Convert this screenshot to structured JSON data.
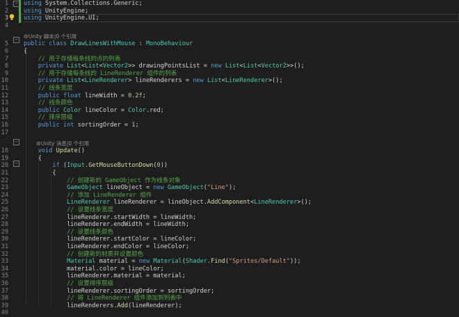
{
  "editor": {
    "lines": [
      {
        "n": "1",
        "segs": [
          [
            "kw",
            "using"
          ],
          [
            "pl",
            " System.Collections.Generic;"
          ]
        ]
      },
      {
        "n": "2",
        "segs": [
          [
            "kw",
            "using"
          ],
          [
            "pl",
            " UnityEngine;"
          ]
        ]
      },
      {
        "n": "3",
        "segs": [
          [
            "kw",
            "using"
          ],
          [
            "pl",
            " UnityEngine.UI;"
          ]
        ]
      },
      {
        "n": "4",
        "segs": []
      },
      {
        "lens": "⚙Unity 脚本|0 个引用"
      },
      {
        "n": "5",
        "segs": [
          [
            "kw",
            "public"
          ],
          [
            "pl",
            " "
          ],
          [
            "kw",
            "class"
          ],
          [
            "pl",
            " "
          ],
          [
            "ty",
            "DrawLinesWithMouse"
          ],
          [
            "pl",
            " : "
          ],
          [
            "ty",
            "MonoBehaviour"
          ]
        ]
      },
      {
        "n": "6",
        "segs": [
          [
            "pl",
            "{"
          ]
        ]
      },
      {
        "n": "7",
        "segs": [
          [
            "pl",
            "    "
          ],
          [
            "cm",
            "// 用于存储每条线的点的列表"
          ]
        ]
      },
      {
        "n": "8",
        "segs": [
          [
            "pl",
            "    "
          ],
          [
            "kw",
            "private"
          ],
          [
            "pl",
            " "
          ],
          [
            "ty",
            "List"
          ],
          [
            "pl",
            "<"
          ],
          [
            "ty",
            "List"
          ],
          [
            "pl",
            "<"
          ],
          [
            "ty",
            "Vector2"
          ],
          [
            "pl",
            ">> drawingPointsList = "
          ],
          [
            "kw",
            "new"
          ],
          [
            "pl",
            " "
          ],
          [
            "ty",
            "List"
          ],
          [
            "pl",
            "<"
          ],
          [
            "ty",
            "List"
          ],
          [
            "pl",
            "<"
          ],
          [
            "ty",
            "Vector2"
          ],
          [
            "pl",
            ">>();"
          ]
        ]
      },
      {
        "n": "9",
        "segs": [
          [
            "pl",
            "    "
          ],
          [
            "cm",
            "// 用于存储每条线的 LineRenderer 组件的列表"
          ]
        ]
      },
      {
        "n": "10",
        "segs": [
          [
            "pl",
            "    "
          ],
          [
            "kw",
            "private"
          ],
          [
            "pl",
            " "
          ],
          [
            "ty",
            "List"
          ],
          [
            "pl",
            "<"
          ],
          [
            "ty",
            "LineRenderer"
          ],
          [
            "pl",
            "> lineRenderers = "
          ],
          [
            "kw",
            "new"
          ],
          [
            "pl",
            " "
          ],
          [
            "ty",
            "List"
          ],
          [
            "pl",
            "<"
          ],
          [
            "ty",
            "LineRenderer"
          ],
          [
            "pl",
            ">();"
          ]
        ]
      },
      {
        "n": "11",
        "segs": [
          [
            "pl",
            "    "
          ],
          [
            "cm",
            "// 线条宽度"
          ]
        ]
      },
      {
        "n": "12",
        "segs": [
          [
            "pl",
            "    "
          ],
          [
            "kw",
            "public"
          ],
          [
            "pl",
            " "
          ],
          [
            "kw",
            "float"
          ],
          [
            "pl",
            " lineWidth = "
          ],
          [
            "num",
            "0.2f"
          ],
          [
            "pl",
            ";"
          ]
        ]
      },
      {
        "n": "13",
        "segs": [
          [
            "pl",
            "    "
          ],
          [
            "cm",
            "// 线条颜色"
          ]
        ]
      },
      {
        "n": "14",
        "segs": [
          [
            "pl",
            "    "
          ],
          [
            "kw",
            "public"
          ],
          [
            "pl",
            " "
          ],
          [
            "ty",
            "Color"
          ],
          [
            "pl",
            " lineColor = "
          ],
          [
            "ty",
            "Color"
          ],
          [
            "pl",
            ".red;"
          ]
        ]
      },
      {
        "n": "15",
        "segs": [
          [
            "pl",
            "    "
          ],
          [
            "cm",
            "// 排序层级"
          ]
        ]
      },
      {
        "n": "16",
        "segs": [
          [
            "pl",
            "    "
          ],
          [
            "kw",
            "public"
          ],
          [
            "pl",
            " "
          ],
          [
            "kw",
            "int"
          ],
          [
            "pl",
            " sortingOrder = "
          ],
          [
            "num",
            "1"
          ],
          [
            "pl",
            ";"
          ]
        ]
      },
      {
        "n": "17",
        "segs": []
      },
      {
        "lens": "⚙Unity 消息|0 个引用"
      },
      {
        "n": "18",
        "segs": [
          [
            "pl",
            "    "
          ],
          [
            "kw",
            "void"
          ],
          [
            "pl",
            " "
          ],
          [
            "fn",
            "Update"
          ],
          [
            "pl",
            "()"
          ]
        ]
      },
      {
        "n": "19",
        "segs": [
          [
            "pl",
            "    {"
          ]
        ]
      },
      {
        "n": "20",
        "segs": [
          [
            "pl",
            "        "
          ],
          [
            "kw",
            "if"
          ],
          [
            "pl",
            " ("
          ],
          [
            "ty",
            "Input"
          ],
          [
            "pl",
            "."
          ],
          [
            "fn",
            "GetMouseButtonDown"
          ],
          [
            "pl",
            "("
          ],
          [
            "num",
            "0"
          ],
          [
            "pl",
            "))"
          ]
        ]
      },
      {
        "n": "21",
        "segs": [
          [
            "pl",
            "        {"
          ]
        ]
      },
      {
        "n": "22",
        "segs": [
          [
            "pl",
            "            "
          ],
          [
            "cm",
            "// 创建新的 GameObject 作为线条对象"
          ]
        ]
      },
      {
        "n": "23",
        "segs": [
          [
            "pl",
            "            "
          ],
          [
            "ty",
            "GameObject"
          ],
          [
            "pl",
            " lineObject = "
          ],
          [
            "kw",
            "new"
          ],
          [
            "pl",
            " "
          ],
          [
            "ty",
            "GameObject"
          ],
          [
            "pl",
            "("
          ],
          [
            "str",
            "\"Line\""
          ],
          [
            "pl",
            ");"
          ]
        ]
      },
      {
        "n": "24",
        "segs": [
          [
            "pl",
            "            "
          ],
          [
            "cm",
            "// 添加 LineRenderer 组件"
          ]
        ]
      },
      {
        "n": "25",
        "segs": [
          [
            "pl",
            "            "
          ],
          [
            "ty",
            "LineRenderer"
          ],
          [
            "pl",
            " lineRenderer = lineObject."
          ],
          [
            "fn",
            "AddComponent"
          ],
          [
            "pl",
            "<"
          ],
          [
            "ty",
            "LineRenderer"
          ],
          [
            "pl",
            ">();"
          ]
        ]
      },
      {
        "n": "26",
        "segs": [
          [
            "pl",
            "            "
          ],
          [
            "cm",
            "// 设置线条宽度"
          ]
        ]
      },
      {
        "n": "27",
        "segs": [
          [
            "pl",
            "            lineRenderer.startWidth = lineWidth;"
          ]
        ]
      },
      {
        "n": "28",
        "segs": [
          [
            "pl",
            "            lineRenderer.endWidth = lineWidth;"
          ]
        ]
      },
      {
        "n": "29",
        "segs": [
          [
            "pl",
            "            "
          ],
          [
            "cm",
            "// 设置线条颜色"
          ]
        ]
      },
      {
        "n": "30",
        "segs": [
          [
            "pl",
            "            lineRenderer.startColor = lineColor;"
          ]
        ]
      },
      {
        "n": "31",
        "segs": [
          [
            "pl",
            "            lineRenderer.endColor = lineColor;"
          ]
        ]
      },
      {
        "n": "32",
        "segs": [
          [
            "pl",
            "            "
          ],
          [
            "cm",
            "// 创建新的材质并设置颜色"
          ]
        ]
      },
      {
        "n": "33",
        "segs": [
          [
            "pl",
            "            "
          ],
          [
            "ty",
            "Material"
          ],
          [
            "pl",
            " material = "
          ],
          [
            "kw",
            "new"
          ],
          [
            "pl",
            " "
          ],
          [
            "ty",
            "Material"
          ],
          [
            "pl",
            "("
          ],
          [
            "ty",
            "Shader"
          ],
          [
            "pl",
            "."
          ],
          [
            "fn",
            "Find"
          ],
          [
            "pl",
            "("
          ],
          [
            "str",
            "\"Sprites/Default\""
          ],
          [
            "pl",
            "));"
          ]
        ]
      },
      {
        "n": "34",
        "segs": [
          [
            "pl",
            "            material.color = lineColor;"
          ]
        ]
      },
      {
        "n": "35",
        "segs": [
          [
            "pl",
            "            lineRenderer.material = material;"
          ]
        ]
      },
      {
        "n": "36",
        "segs": [
          [
            "pl",
            "            "
          ],
          [
            "cm",
            "// 设置排序层级"
          ]
        ]
      },
      {
        "n": "37",
        "segs": [
          [
            "pl",
            "            lineRenderer.sortingOrder = sortingOrder;"
          ]
        ]
      },
      {
        "n": "38",
        "segs": [
          [
            "pl",
            "            "
          ],
          [
            "cm",
            "// 将 LineRenderer 组件添加到列表中"
          ]
        ]
      },
      {
        "n": "39",
        "segs": [
          [
            "pl",
            "            lineRenderers."
          ],
          [
            "fn",
            "Add"
          ],
          [
            "pl",
            "(lineRenderer);"
          ]
        ]
      },
      {
        "n": "40",
        "segs": []
      }
    ]
  }
}
